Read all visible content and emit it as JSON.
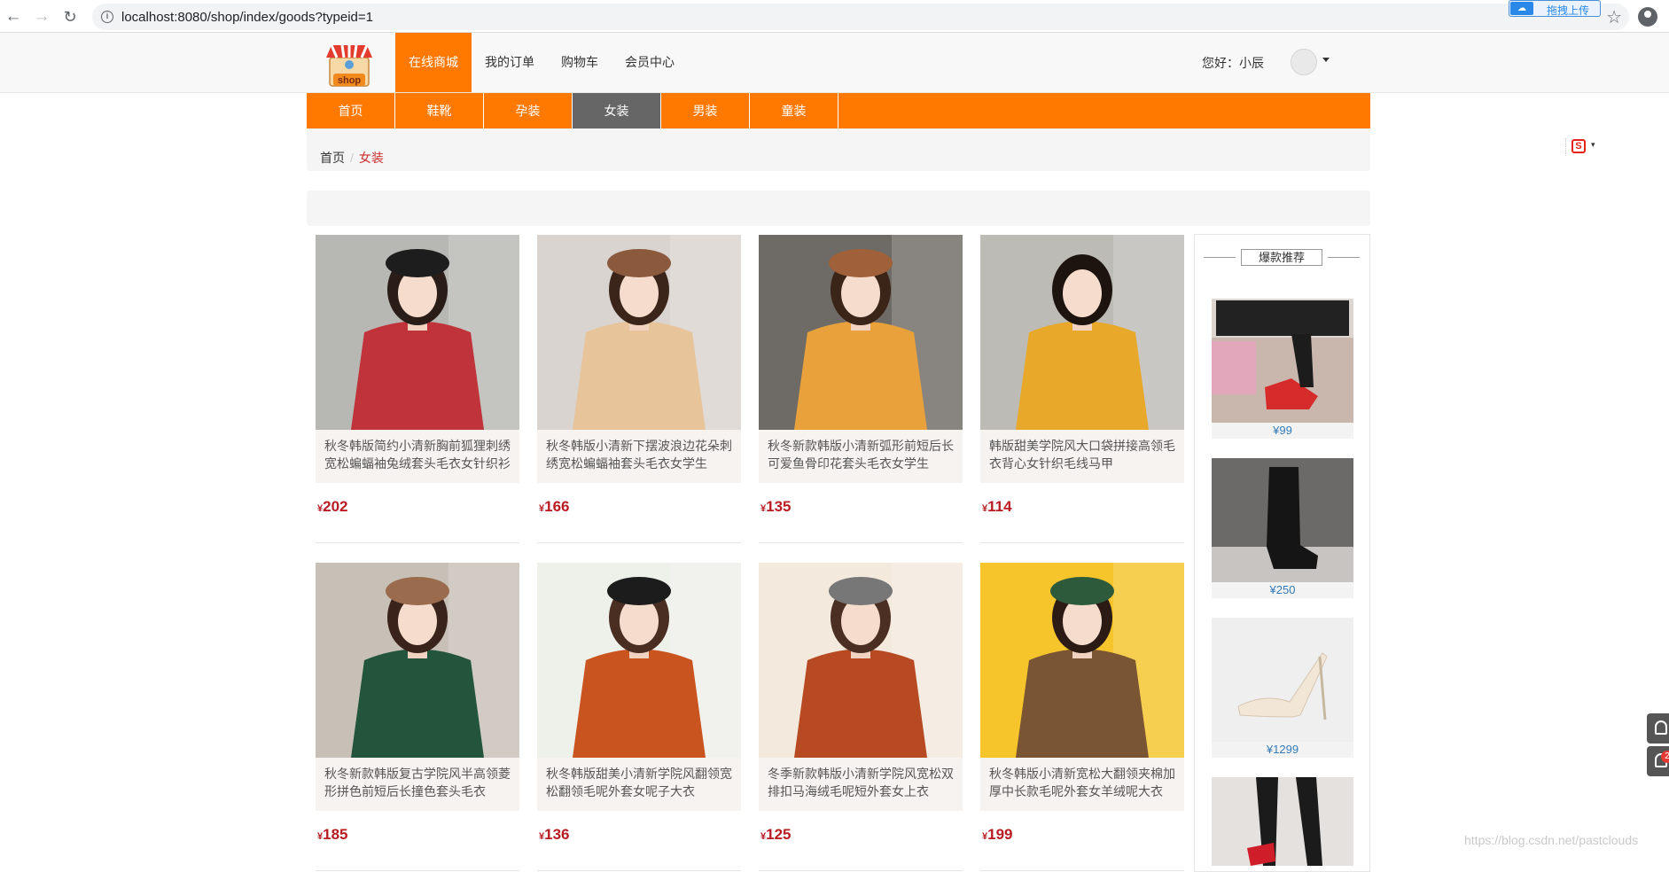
{
  "browser": {
    "url": "localhost:8080/shop/index/goods?typeid=1",
    "extension_label": "拖拽上传"
  },
  "header": {
    "logo_text": "shop",
    "nav": [
      "在线商城",
      "我的订单",
      "购物车",
      "会员中心"
    ],
    "active_nav": 0,
    "greeting": "您好：小辰"
  },
  "categories": {
    "items": [
      "首页",
      "鞋靴",
      "孕装",
      "女装",
      "男装",
      "童装"
    ],
    "active": 3
  },
  "breadcrumb": {
    "home": "首页",
    "current": "女装"
  },
  "products": [
    {
      "name": "秋冬韩版简约小清新胸前狐狸刺绣宽松蝙蝠袖兔绒套头毛衣女针织衫",
      "currency": "¥",
      "price": "202",
      "bg": "#b7b7b3",
      "cloth": "#c0333b",
      "hair": "#2a1d18",
      "hat": "#1d1d1d"
    },
    {
      "name": "秋冬韩版小清新下摆波浪边花朵刺绣宽松蝙蝠袖套头毛衣女学生",
      "currency": "¥",
      "price": "166",
      "bg": "#d9d4cf",
      "cloth": "#e8c49b",
      "hair": "#3b251b",
      "hat": "#8b5a3c"
    },
    {
      "name": "秋冬新款韩版小清新弧形前短后长可爱鱼骨印花套头毛衣女学生",
      "currency": "¥",
      "price": "135",
      "bg": "#6e6b66",
      "cloth": "#e9a13b",
      "hair": "#3b2418",
      "hat": "#a0603a"
    },
    {
      "name": "韩版甜美学院风大口袋拼接高领毛衣背心女针织毛线马甲",
      "currency": "¥",
      "price": "114",
      "bg": "#bdbbb6",
      "cloth": "#e8a82a",
      "hair": "#1d1410",
      "hat": ""
    },
    {
      "name": "秋冬新款韩版复古学院风半高领菱形拼色前短后长撞色套头毛衣",
      "currency": "¥",
      "price": "185",
      "bg": "#c8c0b6",
      "cloth": "#23553d",
      "hair": "#3a231a",
      "hat": "#9a6b4d"
    },
    {
      "name": "秋冬韩版甜美小清新学院风翻领宽松翻领毛呢外套女呢子大衣",
      "currency": "¥",
      "price": "136",
      "bg": "#eef0ea",
      "cloth": "#c9541f",
      "hair": "#4a2e22",
      "hat": "#1c1c1c"
    },
    {
      "name": "冬季新款韩版小清新学院风宽松双排扣马海绒毛呢短外套女上衣",
      "currency": "¥",
      "price": "125",
      "bg": "#f3e9dd",
      "cloth": "#b74a23",
      "hair": "#4a2f22",
      "hat": "#777"
    },
    {
      "name": "秋冬韩版小清新宽松大翻领夹棉加厚中长款毛呢外套女羊绒呢大衣",
      "currency": "¥",
      "price": "199",
      "bg": "#f5c52b",
      "cloth": "#7a5533",
      "hair": "#2c1b14",
      "hat": "#2d5a3b"
    }
  ],
  "recommend": {
    "title": "爆款推荐",
    "items": [
      {
        "currency": "¥",
        "price": "99"
      },
      {
        "currency": "¥",
        "price": "250"
      },
      {
        "currency": "¥",
        "price": "1299"
      },
      {
        "currency": "¥",
        "price": ""
      }
    ]
  },
  "float_badge": "2",
  "watermark": "https://blog.csdn.net/pastclouds"
}
